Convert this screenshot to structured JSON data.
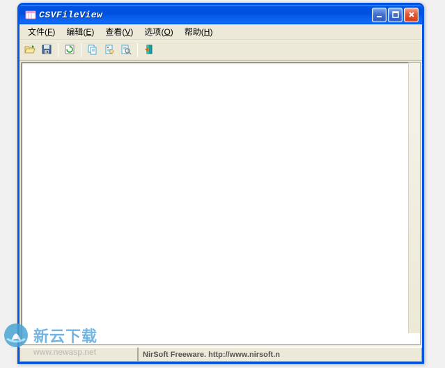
{
  "window": {
    "title": "CSVFileView"
  },
  "menu": {
    "file": {
      "label": "文件",
      "accel": "F"
    },
    "edit": {
      "label": "编辑",
      "accel": "E"
    },
    "view": {
      "label": "查看",
      "accel": "V"
    },
    "options": {
      "label": "选项",
      "accel": "O"
    },
    "help": {
      "label": "帮助",
      "accel": "H"
    }
  },
  "toolbar": {
    "open": "open-icon",
    "save": "save-icon",
    "refresh": "refresh-icon",
    "copy": "copy-icon",
    "properties": "properties-icon",
    "find": "find-icon",
    "exit": "exit-icon"
  },
  "status": {
    "left": "",
    "right": "NirSoft Freeware.  http://www.nirsoft.n"
  },
  "watermark": {
    "zh": "新云下载",
    "url": "www.newasp.net"
  }
}
